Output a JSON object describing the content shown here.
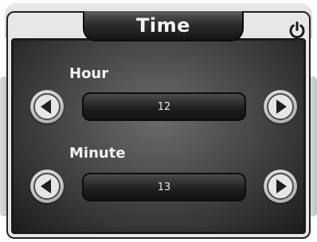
{
  "window": {
    "title": "Time",
    "power_icon": "power-icon"
  },
  "hour": {
    "label": "Hour",
    "value": "12",
    "decrement_icon": "arrow-left-icon",
    "increment_icon": "arrow-right-icon"
  },
  "minute": {
    "label": "Minute",
    "value": "13",
    "decrement_icon": "arrow-left-icon",
    "increment_icon": "arrow-right-icon"
  },
  "colors": {
    "screen_bg": "#3f4142",
    "text": "#f2f2f2",
    "frame": "#e5e7e8"
  }
}
